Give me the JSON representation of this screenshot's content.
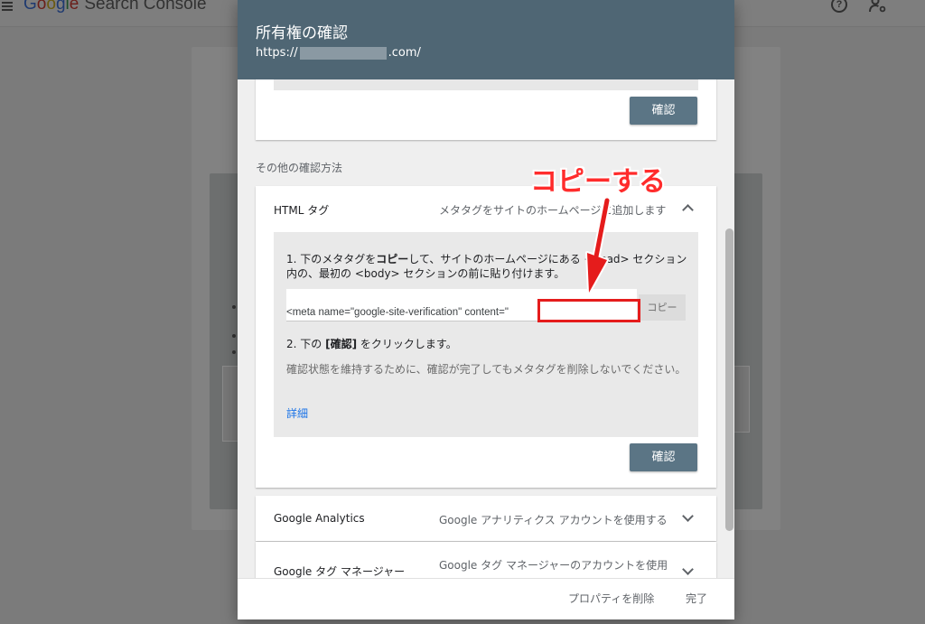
{
  "app": {
    "logo_letters": [
      "G",
      "o",
      "o",
      "g",
      "l",
      "e"
    ],
    "logo_rest": "Search Console",
    "help_icon": "?",
    "icons": [
      "menu-icon",
      "help-icon",
      "user-settings-icon"
    ]
  },
  "dialog": {
    "title": "所有権の確認",
    "url_prefix": "https://",
    "url_suffix": ".com/",
    "top_card": {
      "confirm_label": "確認"
    },
    "other_methods_label": "その他の確認方法",
    "html_tag": {
      "title": "HTML タグ",
      "description": "メタタグをサイトのホームページに追加します",
      "step1_pre": "1. 下のメタタグを",
      "step1_bold": "コピー",
      "step1_post": "して、サイトのホームページにある <head> セクション内の、最初の <body> セクションの前に貼り付けます。",
      "meta_value": "<meta name=\"google-site-verification\" content=\"",
      "copy_label": "コピー",
      "step2_pre": "2. 下の ",
      "step2_bold": "[確認]",
      "step2_post": " をクリックします。",
      "note": "確認状態を維持するために、確認が完了してもメタタグを削除しないでください。",
      "details_link": "詳細",
      "confirm_label": "確認"
    },
    "google_analytics": {
      "title": "Google Analytics",
      "description": "Google アナリティクス アカウントを使用する"
    },
    "google_tag_manager": {
      "title": "Google タグ マネージャー",
      "description": "Google タグ マネージャーのアカウントを使用"
    },
    "footer": {
      "delete_label": "プロパティを削除",
      "done_label": "完了"
    }
  },
  "annotation": {
    "text": "コピーする",
    "color": "#ff2c2c"
  },
  "colors": {
    "header_bg": "#4f6674",
    "button_bg": "#5b7585",
    "link": "#1a73e8",
    "overlay": "#7b7b7b"
  }
}
